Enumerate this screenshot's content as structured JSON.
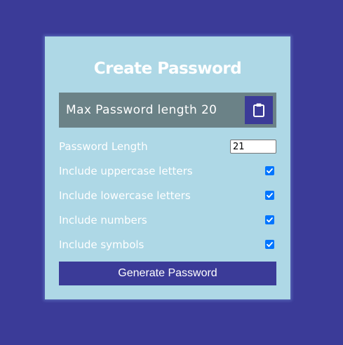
{
  "title": "Create Password",
  "result": {
    "text": "Max Password length 20",
    "clipboard_icon": "clipboard-icon"
  },
  "settings": {
    "length": {
      "label": "Password Length",
      "value": "21"
    },
    "uppercase": {
      "label": "Include uppercase letters",
      "checked": true
    },
    "lowercase": {
      "label": "Include lowercase letters",
      "checked": true
    },
    "numbers": {
      "label": "Include numbers",
      "checked": true
    },
    "symbols": {
      "label": "Include symbols",
      "checked": true
    }
  },
  "generate_button": {
    "label": "Generate Password"
  },
  "colors": {
    "background": "#3b3b98",
    "card": "#aed8e6",
    "result_box": "#6b8287",
    "accent": "#3b3b98",
    "checkbox": "#0075ff"
  }
}
